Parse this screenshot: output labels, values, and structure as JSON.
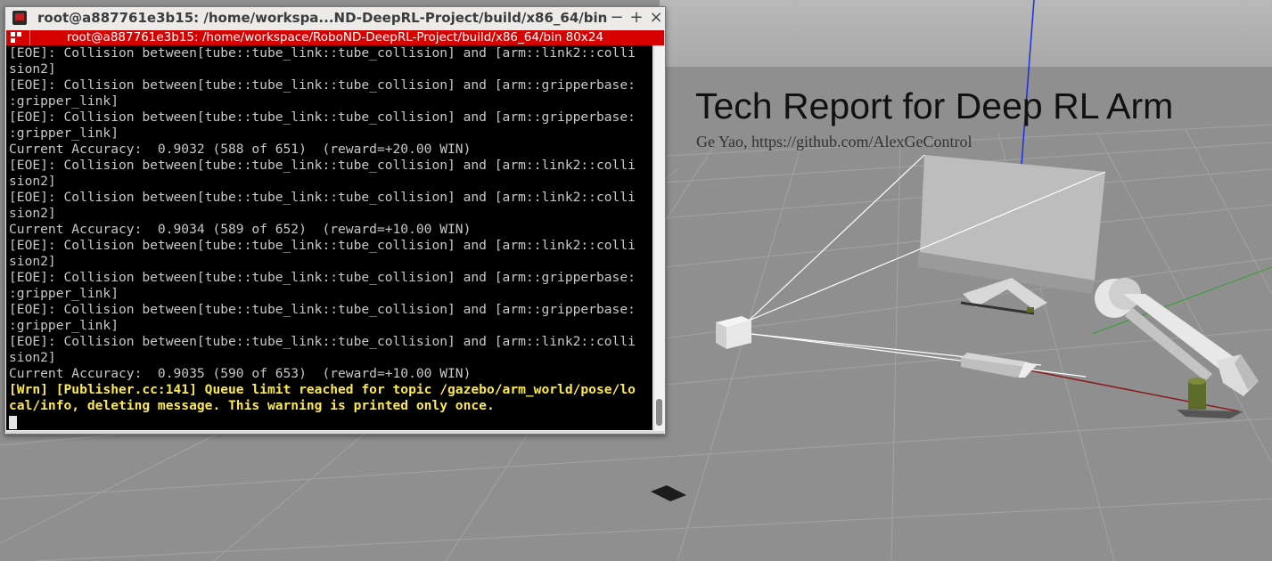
{
  "scene": {
    "report_title": "Tech Report for Deep RL Arm",
    "report_subtitle": "Ge Yao, https://github.com/AlexGeControl"
  },
  "terminal": {
    "window_title": "root@a887761e3b15: /home/workspa...ND-DeepRL-Project/build/x86_64/bin",
    "tab_title": "root@a887761e3b15: /home/workspace/RoboND-DeepRL-Project/build/x86_64/bin 80x24",
    "buttons": {
      "minimize": "−",
      "maximize": "+",
      "close": "×"
    },
    "lines": [
      "[EOE]: Collision between[tube::tube_link::tube_collision] and [arm::link2::colli",
      "sion2]",
      "[EOE]: Collision between[tube::tube_link::tube_collision] and [arm::gripperbase:",
      ":gripper_link]",
      "[EOE]: Collision between[tube::tube_link::tube_collision] and [arm::gripperbase:",
      ":gripper_link]",
      "Current Accuracy:  0.9032 (588 of 651)  (reward=+20.00 WIN)",
      "[EOE]: Collision between[tube::tube_link::tube_collision] and [arm::link2::colli",
      "sion2]",
      "[EOE]: Collision between[tube::tube_link::tube_collision] and [arm::link2::colli",
      "sion2]",
      "Current Accuracy:  0.9034 (589 of 652)  (reward=+10.00 WIN)",
      "[EOE]: Collision between[tube::tube_link::tube_collision] and [arm::link2::colli",
      "sion2]",
      "[EOE]: Collision between[tube::tube_link::tube_collision] and [arm::gripperbase:",
      ":gripper_link]",
      "[EOE]: Collision between[tube::tube_link::tube_collision] and [arm::gripperbase:",
      ":gripper_link]",
      "[EOE]: Collision between[tube::tube_link::tube_collision] and [arm::link2::colli",
      "sion2]",
      "Current Accuracy:  0.9035 (590 of 653)  (reward=+10.00 WIN)"
    ],
    "warn_lines": [
      "[Wrn] [Publisher.cc:141] Queue limit reached for topic /gazebo/arm_world/pose/lo",
      "cal/info, deleting message. This warning is printed only once."
    ],
    "colors": {
      "tab_bar": "#d50000",
      "warning_text": "#fce94f",
      "terminal_bg": "#000000"
    }
  }
}
